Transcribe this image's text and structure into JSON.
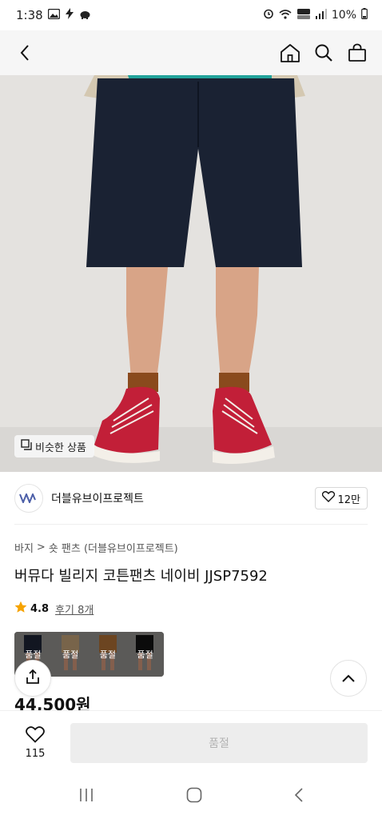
{
  "status_bar": {
    "time": "1:38",
    "battery": "10%",
    "icons": [
      "gallery-icon",
      "bolt-icon",
      "piggy-icon",
      "alarm-icon",
      "wifi-icon",
      "hd-voice-icon",
      "signal-icon",
      "battery-icon"
    ]
  },
  "top_nav": {
    "icons": [
      "back-icon",
      "home-icon",
      "search-icon",
      "bag-icon"
    ]
  },
  "hero": {
    "similar_label": "비슷한 상품"
  },
  "brand": {
    "name": "더블유브이프로젝트",
    "likes": "12만"
  },
  "breadcrumb": {
    "category": "바지",
    "separator": ">",
    "subcategory": "숏 팬츠 (더블유브이프로젝트)"
  },
  "product": {
    "title": "버뮤다 빌리지 코튼팬츠 네이비 JJSP7592",
    "price": "44,500원"
  },
  "rating": {
    "score": "4.8",
    "reviews": "후기 8개",
    "star_color": "#f6a300"
  },
  "options": [
    {
      "label": "품절"
    },
    {
      "label": "품절"
    },
    {
      "label": "품절"
    },
    {
      "label": "품절"
    }
  ],
  "bottom_bar": {
    "wish_count": "115",
    "buy_label": "품절"
  },
  "colors": {
    "nav_bg": "#f6f6f6",
    "disabled_bg": "#ededed",
    "disabled_text": "#b3b3b3"
  }
}
